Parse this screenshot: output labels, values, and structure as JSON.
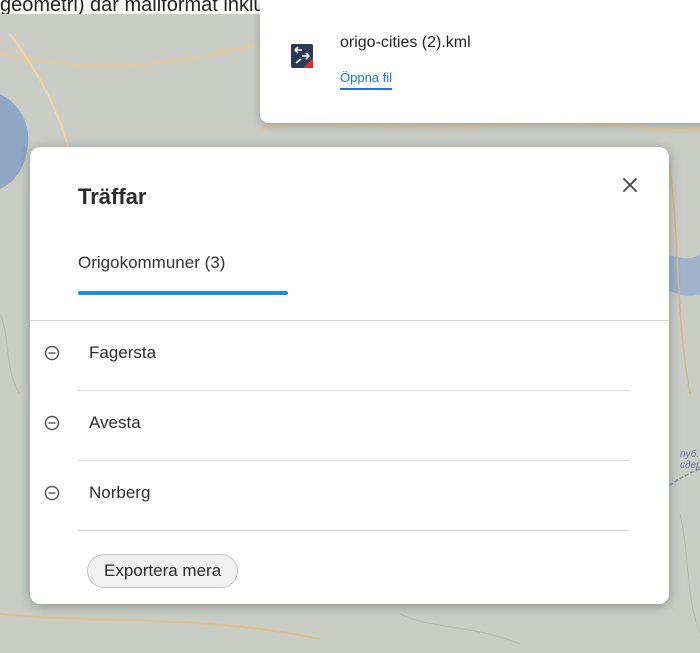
{
  "background_text": "geometri) där mailformat inkluderar kml och geojson",
  "map": {
    "label": "пуб. сдерит"
  },
  "download": {
    "filename": "origo-cities (2).kml",
    "open_label": "Öppna fil",
    "icon": "kml-file-icon"
  },
  "results": {
    "title": "Träffar",
    "close_icon": "close-icon",
    "tabs": [
      {
        "label": "Origokommuner (3)",
        "active": true
      }
    ],
    "items": [
      {
        "label": "Fagersta",
        "icon": "remove-circle-icon"
      },
      {
        "label": "Avesta",
        "icon": "remove-circle-icon"
      },
      {
        "label": "Norberg",
        "icon": "remove-circle-icon"
      }
    ],
    "export_label": "Exportera mera"
  },
  "colors": {
    "accent": "#1a8cf0",
    "link": "#1a73e8",
    "map_land": "#c9cdc6",
    "map_water": "#8fa6c4"
  }
}
